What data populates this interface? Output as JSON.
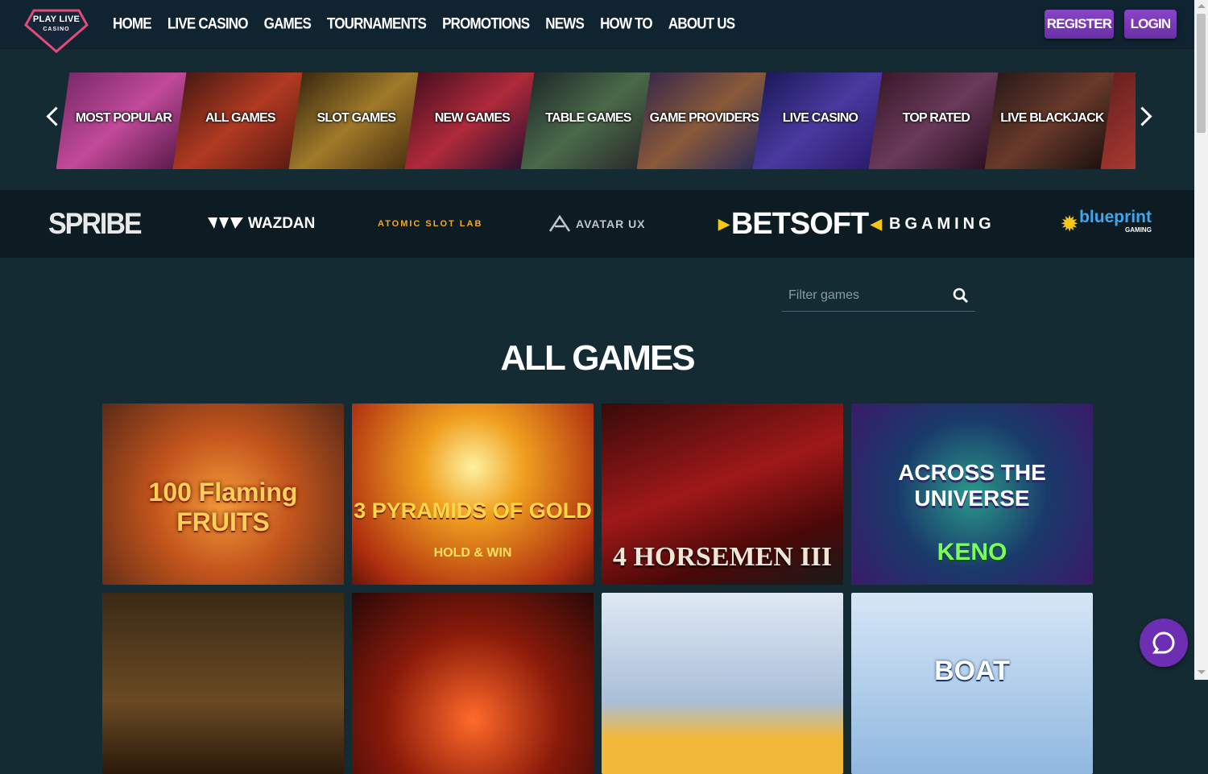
{
  "logo": {
    "line1": "PLAY LIVE",
    "line2": "CASINO"
  },
  "nav": [
    "HOME",
    "LIVE CASINO",
    "GAMES",
    "TOURNAMENTS",
    "PROMOTIONS",
    "NEWS",
    "HOW TO",
    "ABOUT US"
  ],
  "auth": {
    "register": "REGISTER",
    "login": "LOGIN"
  },
  "categories": [
    "MOST POPULAR",
    "ALL GAMES",
    "SLOT GAMES",
    "NEW GAMES",
    "TABLE GAMES",
    "GAME PROVIDERS",
    "LIVE CASINO",
    "TOP RATED",
    "LIVE BLACKJACK"
  ],
  "providers": [
    "SPRIBE",
    "WAZDAN",
    "ATOMIC SLOT LAB",
    "AVATAR UX",
    "BETSOFT",
    "BGAMING",
    "blueprint",
    "GAMING"
  ],
  "search": {
    "placeholder": "Filter games"
  },
  "section_title": "ALL GAMES",
  "games": [
    {
      "title": "100 Flaming FRUITS"
    },
    {
      "title": "3 PYRAMIDS OF GOLD",
      "subtitle": "HOLD & WIN"
    },
    {
      "title": "4 HORSEMEN III"
    },
    {
      "title": "ACROSS THE UNIVERSE",
      "subtitle": "KENO"
    },
    {
      "title": ""
    },
    {
      "title": ""
    },
    {
      "title": ""
    },
    {
      "title": "BOAT"
    }
  ],
  "colors": {
    "accent": "#7b3cbf",
    "background": "#152b33",
    "header": "#0f2430",
    "provider_bar": "#0d1c23"
  }
}
